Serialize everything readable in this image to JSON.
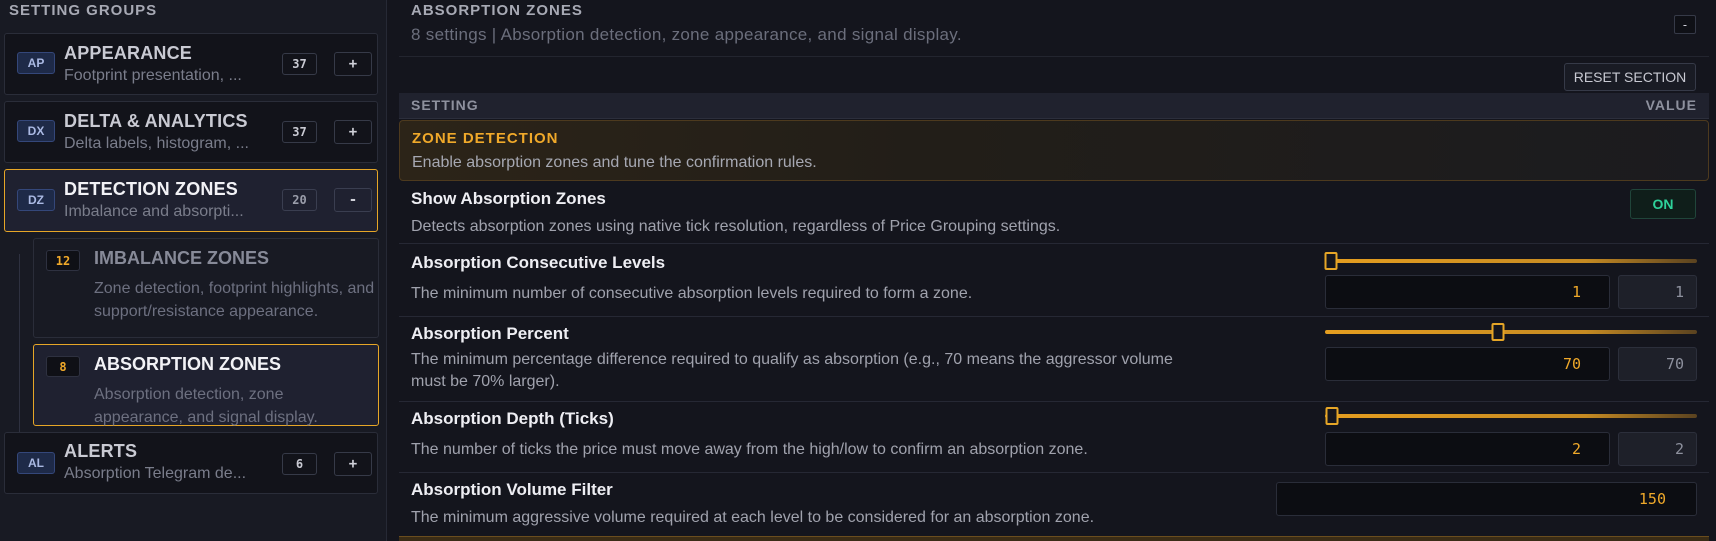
{
  "sidebar": {
    "heading": "SETTING GROUPS",
    "groups": [
      {
        "badge": "AP",
        "title": "APPEARANCE",
        "desc": "Footprint presentation, ...",
        "count": "37",
        "toggle": "+"
      },
      {
        "badge": "DX",
        "title": "DELTA & ANALYTICS",
        "desc": "Delta labels, histogram, ...",
        "count": "37",
        "toggle": "+"
      },
      {
        "badge": "DZ",
        "title": "DETECTION ZONES",
        "desc": "Imbalance and absorpti...",
        "count": "20",
        "toggle": "-"
      },
      {
        "badge": "AL",
        "title": "ALERTS",
        "desc": "Absorption Telegram de...",
        "count": "6",
        "toggle": "+"
      }
    ],
    "subgroups": [
      {
        "count": "12",
        "title": "IMBALANCE ZONES",
        "desc": "Zone detection, footprint highlights, and support/resistance appearance."
      },
      {
        "count": "8",
        "title": "ABSORPTION ZONES",
        "desc": "Absorption detection, zone appearance, and signal display."
      }
    ]
  },
  "section": {
    "title": "ABSORPTION ZONES",
    "meta": "8 settings | Absorption detection, zone appearance, and signal display.",
    "collapse": "-",
    "reset": "RESET SECTION",
    "col_setting": "SETTING",
    "col_value": "VALUE",
    "sub_title": "ZONE DETECTION",
    "sub_desc": "Enable absorption zones and tune the confirmation rules."
  },
  "settings": {
    "show_zones": {
      "label": "Show Absorption Zones",
      "desc": "Detects absorption zones using native tick resolution, regardless of Price Grouping settings.",
      "value": "ON"
    },
    "consecutive": {
      "label": "Absorption Consecutive Levels",
      "desc": "The minimum number of consecutive absorption levels required to form a zone.",
      "value": "1",
      "readout": "1",
      "slider_fraction": 0.0
    },
    "percent": {
      "label": "Absorption Percent",
      "desc": "The minimum percentage difference required to qualify as absorption (e.g., 70 means the aggressor volume must be 70% larger).",
      "value": "70",
      "readout": "70",
      "slider_fraction": 0.465
    },
    "depth": {
      "label": "Absorption Depth (Ticks)",
      "desc": "The number of ticks the price must move away from the high/low to confirm an absorption zone.",
      "value": "2",
      "readout": "2",
      "slider_fraction": 0.018
    },
    "volume_filter": {
      "label": "Absorption Volume Filter",
      "desc": "The minimum aggressive volume required at each level to be considered for an absorption zone.",
      "value": "150"
    }
  },
  "colors": {
    "accent": "#e6a627",
    "on": "#2ed19a",
    "badge": "#1e2a48"
  }
}
